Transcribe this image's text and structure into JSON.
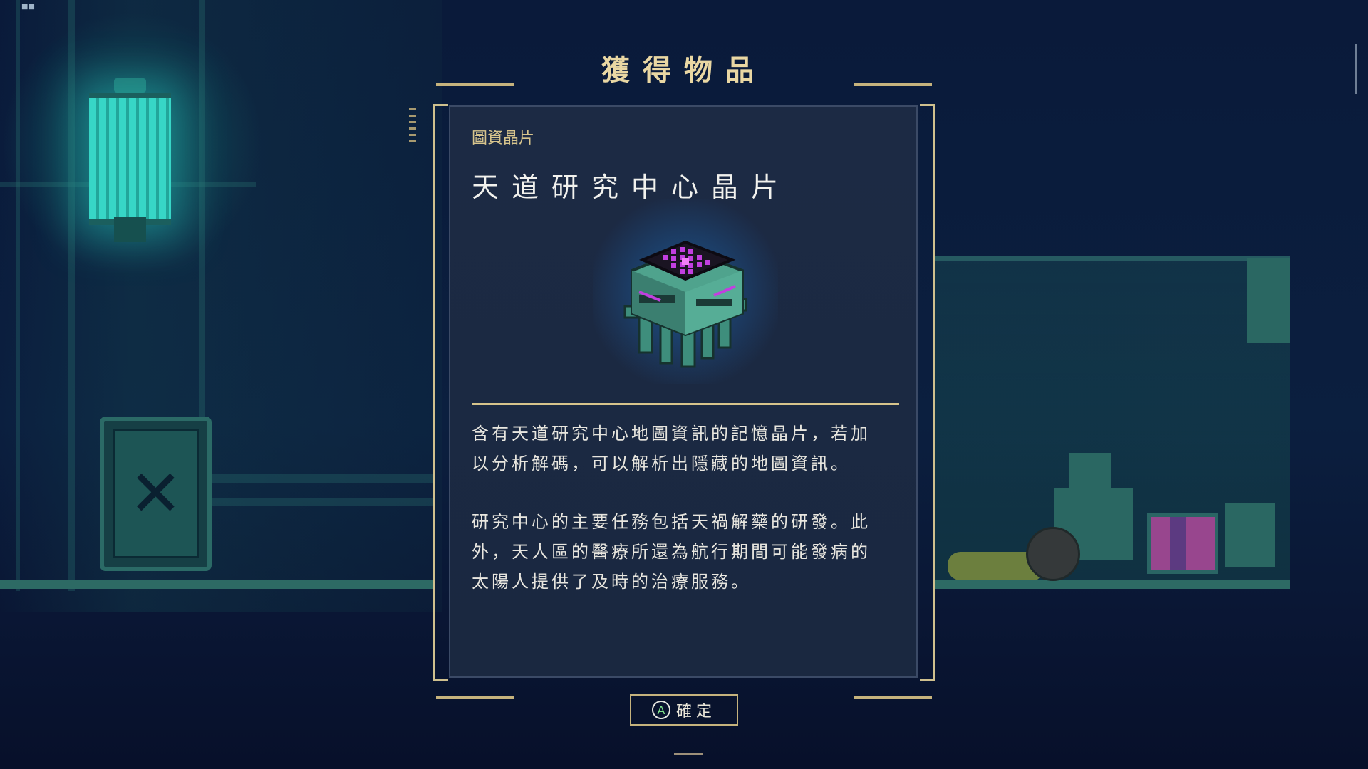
{
  "dialog": {
    "title": "獲得物品",
    "category": "圖資晶片",
    "item_name": "天道研究中心晶片",
    "item_icon": "data-chip-icon",
    "description_p1": "含有天道研究中心地圖資訊的記憶晶片，若加\n以分析解碼，可以解析出隱藏的地圖資訊。",
    "description_p2": "研究中心的主要任務包括天禍解藥的研發。此\n外，天人區的醫療所還為航行期間可能發病的\n太陽人提供了及時的治療服務。"
  },
  "confirm": {
    "button_glyph": "A",
    "label": "確定"
  },
  "colors": {
    "accent_gold": "#c6b37d",
    "title_gold": "#e9d7a3",
    "panel_bg": "#1c2a44",
    "teal_glow": "#37d6c6",
    "chip_purple": "#c23fe0"
  }
}
